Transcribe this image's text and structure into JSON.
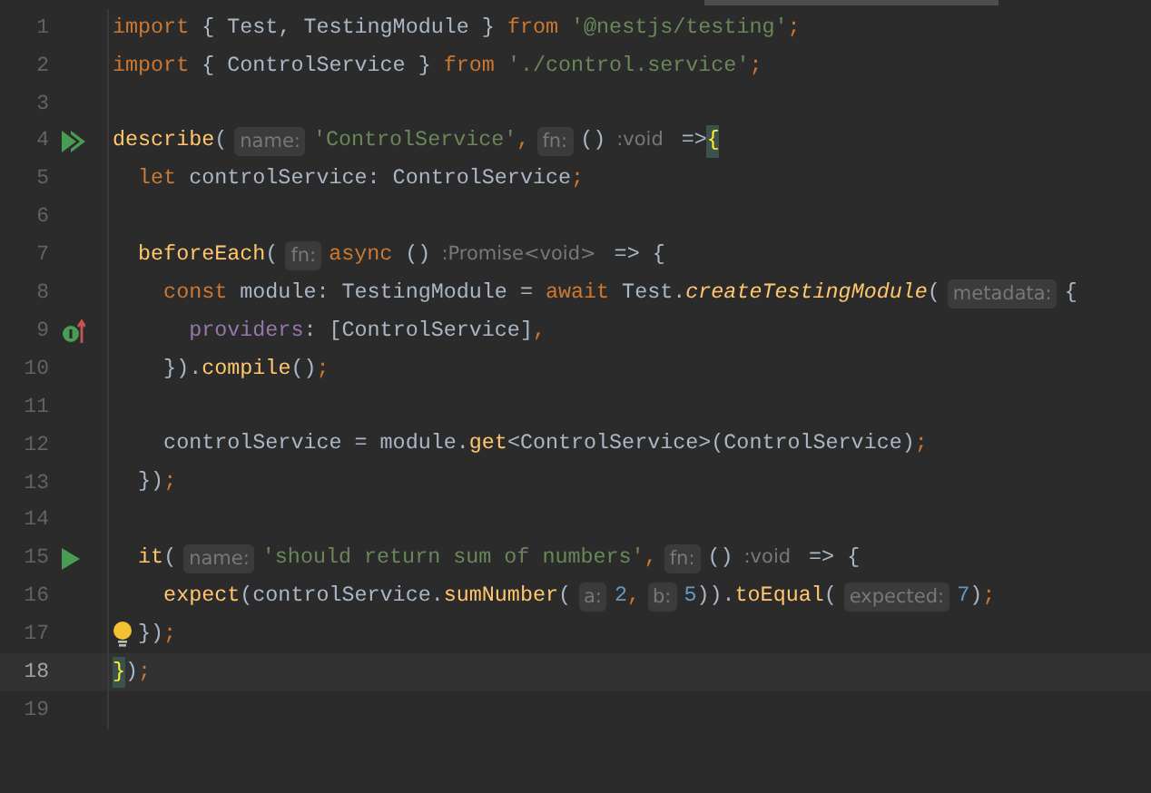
{
  "editor": {
    "lines": [
      {
        "number": "1",
        "current": false,
        "tokens": [
          {
            "kind": "keyword",
            "text": "import"
          },
          {
            "kind": "plain",
            "text": " { Test, TestingModule } "
          },
          {
            "kind": "keyword",
            "text": "from"
          },
          {
            "kind": "string",
            "text": " '@nestjs/testing'"
          },
          {
            "kind": "keyword",
            "text": ";"
          }
        ]
      },
      {
        "number": "2",
        "current": false,
        "tokens": [
          {
            "kind": "keyword",
            "text": "import"
          },
          {
            "kind": "plain",
            "text": " { ControlService } "
          },
          {
            "kind": "keyword",
            "text": "from"
          },
          {
            "kind": "string",
            "text": " './control.service'"
          },
          {
            "kind": "keyword",
            "text": ";"
          }
        ]
      },
      {
        "number": "3",
        "current": false
      },
      {
        "number": "4",
        "current": false,
        "gutter_icon": {
          "kind": "run-all"
        },
        "tokens": [
          {
            "kind": "function",
            "text": "describe"
          },
          {
            "kind": "plain",
            "text": "("
          },
          {
            "kind": "hint",
            "text": "name:"
          },
          {
            "kind": "string",
            "text": "'ControlService'"
          },
          {
            "kind": "keyword",
            "text": ","
          },
          {
            "kind": "hint",
            "text": "fn:"
          },
          {
            "kind": "plain",
            "text": "()"
          },
          {
            "kind": "type-hint",
            "text": ":void"
          },
          {
            "kind": "plain",
            "text": " =>"
          },
          {
            "kind": "brace-match",
            "text": "{"
          }
        ]
      },
      {
        "number": "5",
        "current": false,
        "tokens": [
          {
            "kind": "keyword",
            "text": "  let"
          },
          {
            "kind": "plain",
            "text": " controlService: ControlService"
          },
          {
            "kind": "keyword",
            "text": ";"
          }
        ]
      },
      {
        "number": "6",
        "current": false
      },
      {
        "number": "7",
        "current": false,
        "tokens": [
          {
            "kind": "function",
            "text": "  beforeEach"
          },
          {
            "kind": "plain",
            "text": "("
          },
          {
            "kind": "hint",
            "text": "fn:"
          },
          {
            "kind": "keyword",
            "text": "async"
          },
          {
            "kind": "plain",
            "text": " ()"
          },
          {
            "kind": "type-hint",
            "text": ":Promise<void>"
          },
          {
            "kind": "plain",
            "text": " => {"
          }
        ]
      },
      {
        "number": "8",
        "current": false,
        "tokens": [
          {
            "kind": "keyword",
            "text": "    const"
          },
          {
            "kind": "plain",
            "text": " module: TestingModule = "
          },
          {
            "kind": "keyword",
            "text": "await"
          },
          {
            "kind": "plain",
            "text": " Test."
          },
          {
            "kind": "function-italic",
            "text": "createTestingModule"
          },
          {
            "kind": "plain",
            "text": "("
          },
          {
            "kind": "hint",
            "text": "metadata:"
          },
          {
            "kind": "plain",
            "text": "{"
          }
        ]
      },
      {
        "number": "9",
        "current": false,
        "gutter_icon": {
          "kind": "implements"
        },
        "tokens": [
          {
            "kind": "property",
            "text": "      providers"
          },
          {
            "kind": "plain",
            "text": ": [ControlService]"
          },
          {
            "kind": "keyword",
            "text": ","
          }
        ]
      },
      {
        "number": "10",
        "current": false,
        "tokens": [
          {
            "kind": "plain",
            "text": "    })."
          },
          {
            "kind": "function",
            "text": "compile"
          },
          {
            "kind": "plain",
            "text": "()"
          },
          {
            "kind": "keyword",
            "text": ";"
          }
        ]
      },
      {
        "number": "11",
        "current": false
      },
      {
        "number": "12",
        "current": false,
        "tokens": [
          {
            "kind": "plain",
            "text": "    controlService = module."
          },
          {
            "kind": "function",
            "text": "get"
          },
          {
            "kind": "plain",
            "text": "<ControlService>(ControlService)"
          },
          {
            "kind": "keyword",
            "text": ";"
          }
        ]
      },
      {
        "number": "13",
        "current": false,
        "tokens": [
          {
            "kind": "plain",
            "text": "  })"
          },
          {
            "kind": "keyword",
            "text": ";"
          }
        ]
      },
      {
        "number": "14",
        "current": false
      },
      {
        "number": "15",
        "current": false,
        "gutter_icon": {
          "kind": "run"
        },
        "tokens": [
          {
            "kind": "function",
            "text": "  it"
          },
          {
            "kind": "plain",
            "text": "("
          },
          {
            "kind": "hint",
            "text": "name:"
          },
          {
            "kind": "string",
            "text": "'should return sum of numbers'"
          },
          {
            "kind": "keyword",
            "text": ","
          },
          {
            "kind": "hint",
            "text": "fn:"
          },
          {
            "kind": "plain",
            "text": "()"
          },
          {
            "kind": "type-hint",
            "text": ":void"
          },
          {
            "kind": "plain",
            "text": " => {"
          }
        ]
      },
      {
        "number": "16",
        "current": false,
        "tokens": [
          {
            "kind": "function",
            "text": "    expect"
          },
          {
            "kind": "plain",
            "text": "(controlService."
          },
          {
            "kind": "function",
            "text": "sumNumber"
          },
          {
            "kind": "plain",
            "text": "("
          },
          {
            "kind": "hint",
            "text": "a:"
          },
          {
            "kind": "number",
            "text": "2"
          },
          {
            "kind": "keyword",
            "text": ","
          },
          {
            "kind": "hint",
            "text": "b:"
          },
          {
            "kind": "number",
            "text": "5"
          },
          {
            "kind": "plain",
            "text": "))."
          },
          {
            "kind": "function",
            "text": "toEqual"
          },
          {
            "kind": "plain",
            "text": "("
          },
          {
            "kind": "hint",
            "text": "expected:"
          },
          {
            "kind": "number",
            "text": "7"
          },
          {
            "kind": "plain",
            "text": ")"
          },
          {
            "kind": "keyword",
            "text": ";"
          }
        ]
      },
      {
        "number": "17",
        "current": false,
        "bulb": true,
        "tokens": [
          {
            "kind": "plain",
            "text": "})"
          },
          {
            "kind": "keyword",
            "text": ";"
          }
        ]
      },
      {
        "number": "18",
        "current": true,
        "tokens": [
          {
            "kind": "brace-match",
            "text": "}"
          },
          {
            "kind": "plain",
            "text": ")"
          },
          {
            "kind": "keyword",
            "text": ";"
          }
        ]
      },
      {
        "number": "19",
        "current": false
      }
    ]
  }
}
